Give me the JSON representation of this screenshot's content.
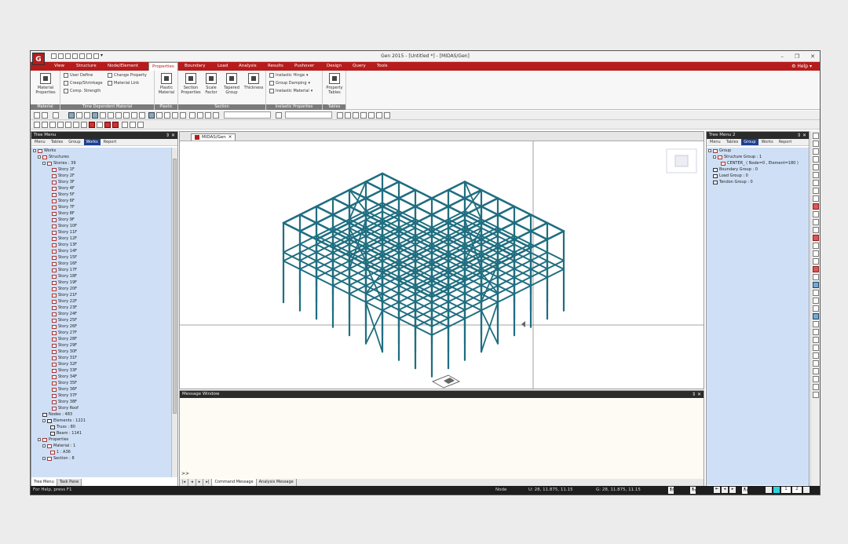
{
  "window": {
    "title": "Gen 2015 - [Untitled *] - [MIDAS/Gen]",
    "logo_text": "G",
    "help_label": "Help"
  },
  "menu_tabs": [
    "View",
    "Structure",
    "Node/Element",
    "Properties",
    "Boundary",
    "Load",
    "Analysis",
    "Results",
    "Pushover",
    "Design",
    "Query",
    "Tools"
  ],
  "ribbon": {
    "material": {
      "btn": "Material Properties",
      "group": "Material"
    },
    "time_dep": {
      "items": [
        "User Define",
        "Change Property",
        "Creep/Shrinkage",
        "Material Link",
        "Comp. Strength"
      ],
      "group": "Time Dependent Material"
    },
    "plastic": {
      "btn": "Plastic Material",
      "group": "Plastic"
    },
    "section": {
      "btns": [
        "Section Properties",
        "Scale Factor",
        "Tapered Group",
        "Thickness"
      ],
      "group": "Section"
    },
    "inelastic": {
      "items": [
        "Inelastic Hinge",
        "Group Damping",
        "Inelastic Material"
      ],
      "group": "Inelastic Properties"
    },
    "tables": {
      "btn": "Property Tables",
      "group": "Tables"
    }
  },
  "left_panel": {
    "title": "Tree Menu",
    "tabs": [
      "Menu",
      "Tables",
      "Group",
      "Works",
      "Report"
    ],
    "selected_tab": "Works",
    "bottom_tabs": [
      "Tree Menu",
      "Task Pane"
    ],
    "tree": {
      "works": "Works",
      "structures": "Structures",
      "stories": "Stories : 39",
      "story_list": [
        "Story 1F",
        "Story 2F",
        "Story 3F",
        "Story 4F",
        "Story 5F",
        "Story 6F",
        "Story 7F",
        "Story 8F",
        "Story 9F",
        "Story 10F",
        "Story 11F",
        "Story 12F",
        "Story 13F",
        "Story 14F",
        "Story 15F",
        "Story 16F",
        "Story 17F",
        "Story 18F",
        "Story 19F",
        "Story 20F",
        "Story 21F",
        "Story 22F",
        "Story 23F",
        "Story 24F",
        "Story 25F",
        "Story 26F",
        "Story 27F",
        "Story 28F",
        "Story 29F",
        "Story 30F",
        "Story 31F",
        "Story 32F",
        "Story 33F",
        "Story 34F",
        "Story 35F",
        "Story 36F",
        "Story 37F",
        "Story 38F",
        "Story Roof"
      ],
      "nodes": "Nodes : 483",
      "elements": "Elements : 1221",
      "truss": "Truss : 80",
      "beam": "Beam : 1141",
      "properties": "Properties",
      "material": "Material : 1",
      "material_item": "1 : A36",
      "section": "Section : 8"
    }
  },
  "doc_tab": {
    "label": "MIDAS/Gen"
  },
  "message_window": {
    "title": "Message Window",
    "tabs": [
      "Command Message",
      "Analysis Message"
    ],
    "prompt": ">>"
  },
  "right_panel": {
    "title": "Tree Menu 2",
    "tabs": [
      "Menu",
      "Tables",
      "Group",
      "Works",
      "Report"
    ],
    "selected_tab": "Group",
    "tree": [
      "Group",
      "Structure Group : 1",
      "CENTER_ ( Node=0 , Element=180 )",
      "Boundary Group : 0",
      "Load Group : 0",
      "Tendon Group : 0"
    ]
  },
  "status": {
    "help": "For Help, press F1",
    "node": "Node",
    "u_coord": "U: 28, 11.875, 11.15",
    "g_coord": "G: 28, 11.875, 11.15",
    "unit_force": "kN",
    "unit_len": "m",
    "view": "none",
    "page": "1",
    "page_total": "2"
  },
  "colors": {
    "accent": "#b71c1c",
    "model": "#1f6e80",
    "tree_bg": "#cfe0f6"
  }
}
